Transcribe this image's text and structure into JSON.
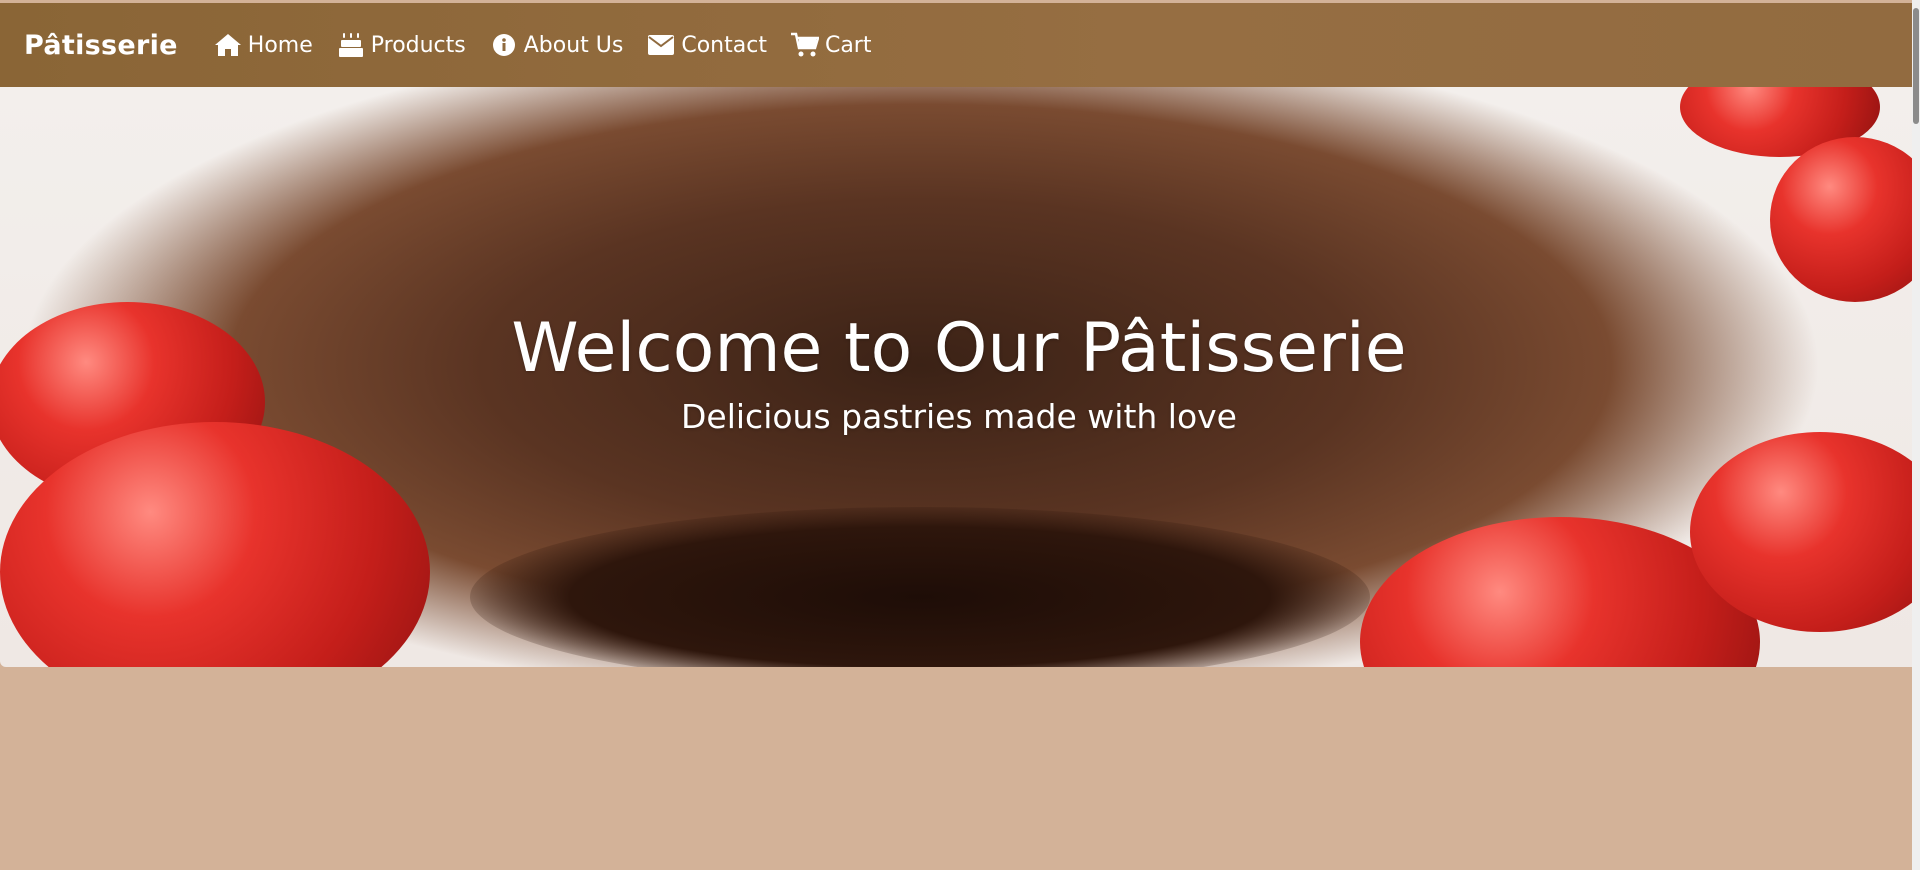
{
  "navbar": {
    "brand": "Pâtisserie",
    "links": [
      {
        "label": "Home",
        "icon": "home-icon"
      },
      {
        "label": "Products",
        "icon": "cake-icon"
      },
      {
        "label": "About Us",
        "icon": "info-icon"
      },
      {
        "label": "Contact",
        "icon": "envelope-icon"
      },
      {
        "label": "Cart",
        "icon": "cart-icon"
      }
    ]
  },
  "hero": {
    "title": "Welcome to Our Pâtisserie",
    "subtitle": "Delicious pastries made with love",
    "image": "chocolate-lava-cake-with-raspberries"
  },
  "colors": {
    "navbar": "#966e42",
    "page_background": "#d3b298",
    "text": "#ffffff"
  }
}
